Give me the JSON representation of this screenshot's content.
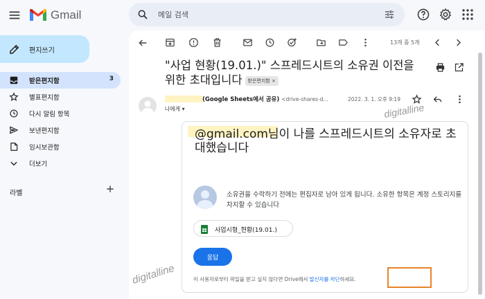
{
  "app": {
    "logo_text": "Gmail",
    "colors": {
      "compose_bg": "#c2e7ff",
      "active_nav_bg": "#d3e3fd",
      "link": "#1a73e8",
      "highlight": "#e8832a",
      "button": "#1a73e8"
    }
  },
  "search": {
    "placeholder": "메일 검색"
  },
  "sidebar": {
    "compose_label": "편지쓰기",
    "items": [
      {
        "label": "받은편지함",
        "icon": "inbox-icon",
        "count": "3",
        "active": true
      },
      {
        "label": "별표편지함",
        "icon": "star-icon"
      },
      {
        "label": "다시 알림 항목",
        "icon": "clock-icon"
      },
      {
        "label": "보낸편지함",
        "icon": "send-icon"
      },
      {
        "label": "임시보관함",
        "icon": "draft-icon"
      },
      {
        "label": "더보기",
        "icon": "chevron-down-icon"
      }
    ],
    "labels_title": "라벨"
  },
  "toolbar": {
    "page_count": "13개 중 5개"
  },
  "message": {
    "subject": "\"사업 현황(19.01.)\" 스프레드시트의 소유권 이전을 위한 초대입니다",
    "inbox_chip": "받은편지함",
    "inbox_chip_close": "×",
    "sender_name": "(Google Sheets에서 공유)",
    "sender_address": "<drive-shares-d...",
    "date": "2022. 3. 1. 오후 9:19",
    "to": "나에게 ▾"
  },
  "card": {
    "title": "@gmail.com님이 나를 스프레드시트의 소유자로 초대했습니다",
    "body": "소유권을 수락하기 전에는 편집자로 남아 있게 됩니다. 소유한 항목은 계정 스토리지를 차지할 수 있습니다",
    "file_name": "사업시형_현황(19.01.)",
    "reply_button": "응답",
    "footer_prefix": "이 사용자로부터 파일을 받고 싶지 않다면 Drive에서 ",
    "footer_link": "발신자를 차단",
    "footer_suffix": "하세요."
  },
  "watermark": "digitalline"
}
